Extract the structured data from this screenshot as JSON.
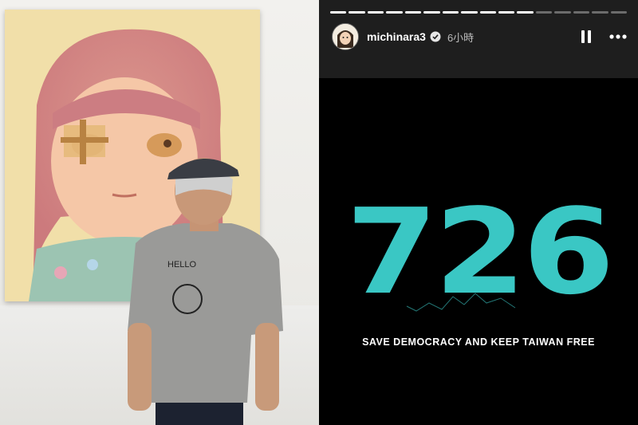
{
  "photo": {
    "description_icon": "photo-artwork-person"
  },
  "story": {
    "username": "michinara3",
    "timestamp": "6小時",
    "verified_icon": "verified-check-icon",
    "progress": {
      "segments": 16,
      "completed": 11
    },
    "controls": {
      "pause_icon": "pause-icon",
      "more_icon": "more-options-icon"
    },
    "headline": "726",
    "tagline": "SAVE DEMOCRACY AND KEEP TAIWAN FREE",
    "colors": {
      "accent": "#3ac7c4",
      "background": "#000000",
      "header": "#1e1e1e"
    }
  }
}
